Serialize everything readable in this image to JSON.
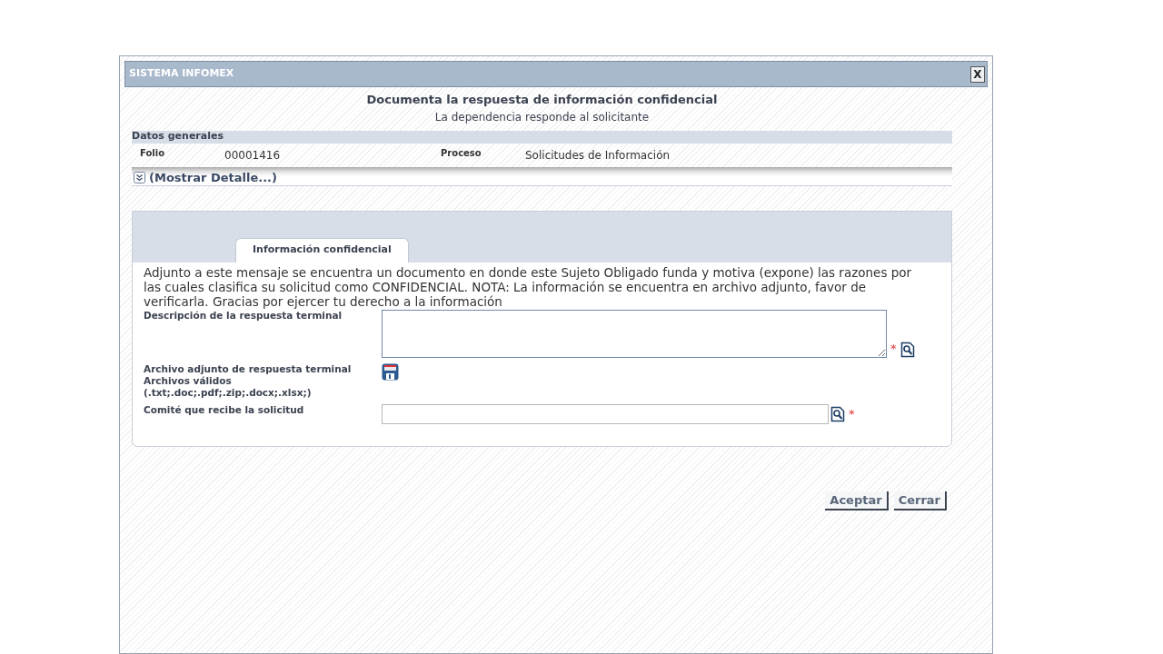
{
  "window": {
    "title": "SISTEMA INFOMEX",
    "close_label": "X"
  },
  "header": {
    "title": "Documenta la respuesta de información confidencial",
    "subtitle": "La dependencia responde al solicitante"
  },
  "general": {
    "heading": "Datos generales",
    "fields": [
      {
        "label": "Folio",
        "value": "00001416"
      },
      {
        "label": "Proceso",
        "value": "Solicitudes de Información"
      }
    ],
    "detail_toggle": "(Mostrar Detalle...)"
  },
  "tabs": [
    {
      "label": "Información confidencial",
      "selected": true
    }
  ],
  "message": "Adjunto a este mensaje se encuentra un documento en donde este Sujeto Obligado funda y motiva (expone) las razones por las cuales clasifica su solicitud como CONFIDENCIAL. NOTA: La información se encuentra en archivo adjunto, favor de verificarla. Gracias por ejercer tu derecho a la información",
  "form": [
    {
      "kind": "textarea",
      "labels": [
        "Descripción de la respuesta terminal"
      ],
      "required_mark": "*"
    },
    {
      "kind": "file",
      "labels": [
        "Archivo adjunto de respuesta terminal",
        "Archivos válidos",
        "(.txt;.doc;.pdf;.zip;.docx;.xlsx;)"
      ]
    },
    {
      "kind": "lookup",
      "labels": [
        "Comité que recibe la solicitud"
      ],
      "required_mark": "*"
    }
  ],
  "buttons": [
    "Aceptar",
    "Cerrar"
  ]
}
